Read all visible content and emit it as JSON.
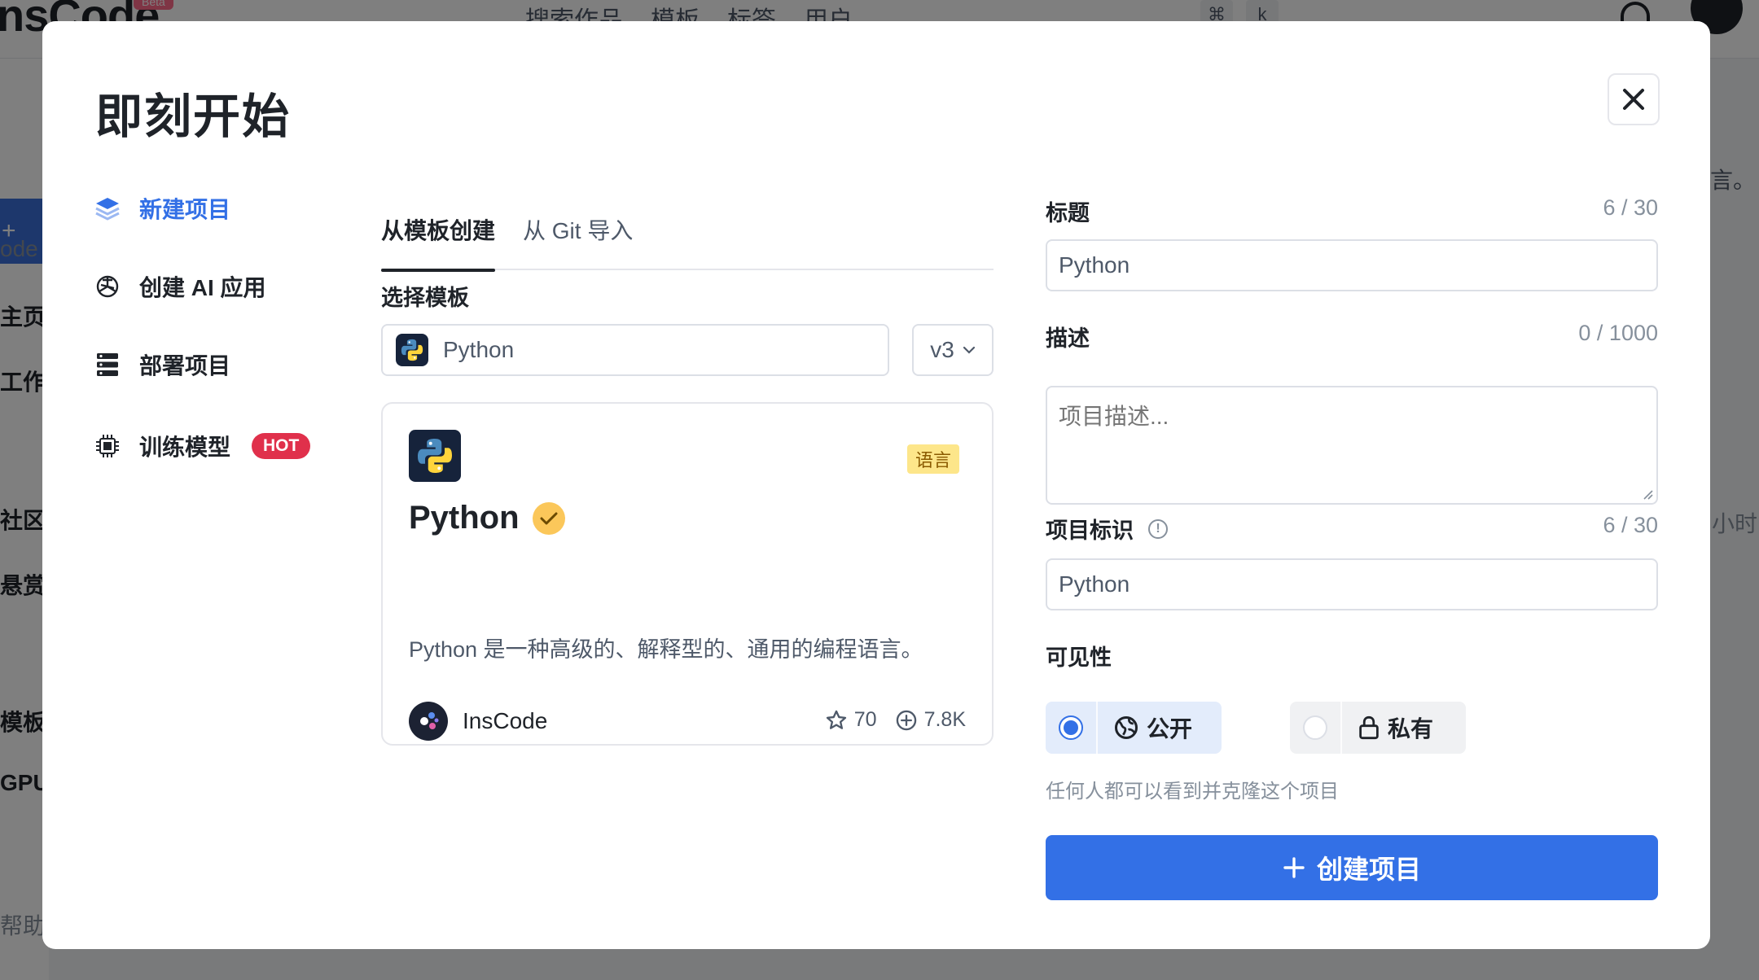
{
  "background": {
    "logo": "nsCode",
    "beta": "Beta",
    "nav": [
      "搜索作品",
      "模板",
      "标签",
      "用户"
    ],
    "kbd": [
      "⌘",
      "k"
    ],
    "sidebar_labels": [
      "ode",
      "主页",
      "工作",
      "社区",
      "悬赏",
      "模板",
      "GPU",
      "帮助"
    ],
    "sidebar_button": "+ 即",
    "right_snippets": [
      "言。",
      "小时"
    ]
  },
  "modal": {
    "title": "即刻开始",
    "menu": [
      {
        "label": "新建项目",
        "icon": "layers-icon",
        "active": true
      },
      {
        "label": "创建 AI 应用",
        "icon": "openai-icon",
        "active": false
      },
      {
        "label": "部署项目",
        "icon": "server-icon",
        "active": false
      },
      {
        "label": "训练模型",
        "icon": "chip-icon",
        "active": false,
        "badge": "HOT"
      }
    ],
    "tabs": [
      "从模板创建",
      "从 Git 导入"
    ],
    "template_label": "选择模板",
    "template_selected": "Python",
    "version_selected": "v3",
    "card": {
      "tag": "语言",
      "name": "Python",
      "description": "Python 是一种高级的、解释型的、通用的编程语言。",
      "author": "InsCode",
      "stars": "70",
      "forks": "7.8K"
    },
    "form": {
      "title_label": "标题",
      "title_counter": "6 / 30",
      "title_value": "Python",
      "desc_label": "描述",
      "desc_counter": "0 / 1000",
      "desc_placeholder": "项目描述...",
      "slug_label": "项目标识",
      "slug_counter": "6 / 30",
      "slug_value": "Python",
      "visibility_label": "可见性",
      "visibility_public": "公开",
      "visibility_private": "私有",
      "visibility_hint": "任何人都可以看到并克隆这个项目",
      "submit": "创建项目"
    }
  },
  "colors": {
    "accent": "#3370e6",
    "hot": "#e0304b",
    "tag_bg": "#fde68a",
    "verified": "#fbc75a"
  }
}
